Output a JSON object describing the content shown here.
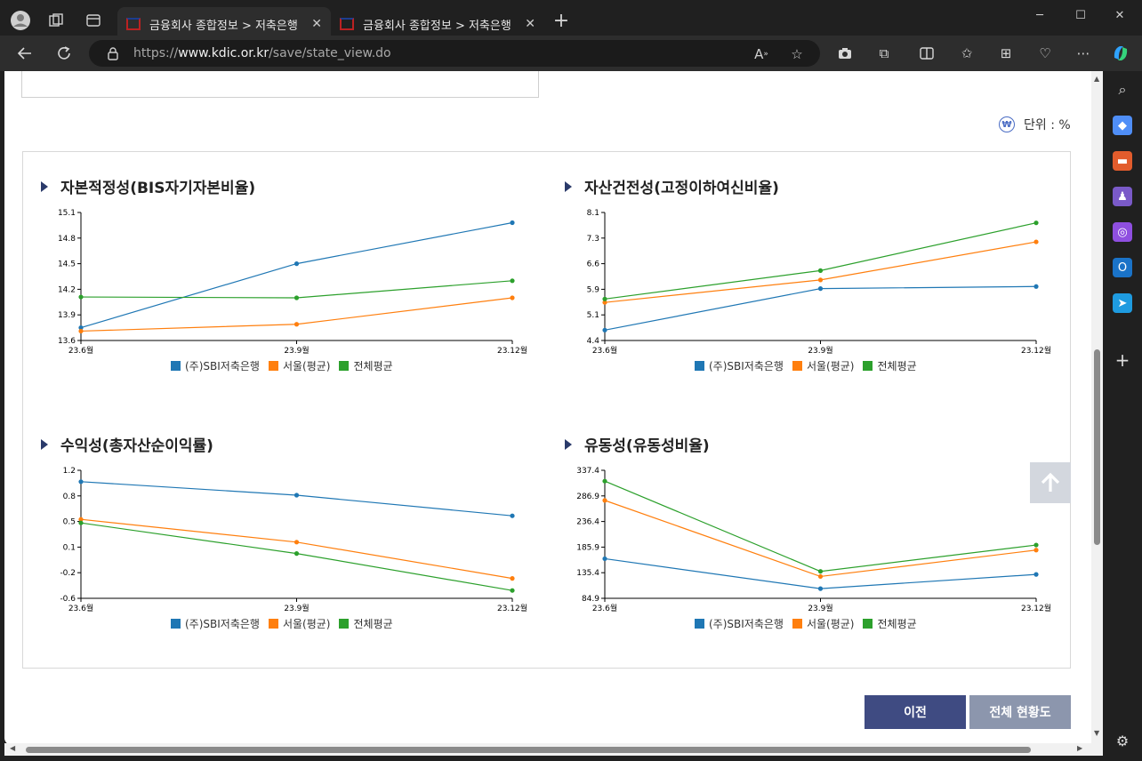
{
  "browser": {
    "tabs": [
      {
        "title": "금융회사 종합정보 > 저축은행 > ..."
      },
      {
        "title": "금융회사 종합정보 > 저축은행 > ..."
      }
    ],
    "url_prefix": "https://",
    "url_host": "www.kdic.or.kr",
    "url_path": "/save/state_view.do",
    "new_tab_label": "+"
  },
  "page": {
    "unit_icon": "₩",
    "unit_label": "단위 : %",
    "prev_button": "이전",
    "all_button": "전체 현황도"
  },
  "colors": {
    "sbi": "#1f77b4",
    "seoul": "#ff7f0e",
    "total": "#2ca02c",
    "accent": "#3f4b82"
  },
  "legend_labels": [
    "(주)SBI저축은행",
    "서울(평균)",
    "전체평균"
  ],
  "chart_data": [
    {
      "type": "line",
      "title": "자본적정성(BIS자기자본비율)",
      "categories": [
        "23.6월",
        "23.9월",
        "23.12월"
      ],
      "yticks": [
        "13.6",
        "13.9",
        "14.2",
        "14.5",
        "14.8",
        "15.1"
      ],
      "ylim": [
        13.6,
        15.1
      ],
      "series": [
        {
          "name": "(주)SBI저축은행",
          "values": [
            13.75,
            14.5,
            14.98
          ]
        },
        {
          "name": "서울(평균)",
          "values": [
            13.71,
            13.79,
            14.1
          ]
        },
        {
          "name": "전체평균",
          "values": [
            14.11,
            14.1,
            14.3
          ]
        }
      ]
    },
    {
      "type": "line",
      "title": "자산건전성(고정이하여신비율)",
      "categories": [
        "23.6월",
        "23.9월",
        "23.12월"
      ],
      "yticks": [
        "4.4",
        "5.1",
        "5.9",
        "6.6",
        "7.3",
        "8.1"
      ],
      "ylim": [
        4.4,
        8.1
      ],
      "series": [
        {
          "name": "(주)SBI저축은행",
          "values": [
            4.7,
            5.9,
            5.96
          ]
        },
        {
          "name": "서울(평균)",
          "values": [
            5.5,
            6.15,
            7.25
          ]
        },
        {
          "name": "전체평균",
          "values": [
            5.6,
            6.42,
            7.8
          ]
        }
      ]
    },
    {
      "type": "line",
      "title": "수익성(총자산순이익률)",
      "categories": [
        "23.6월",
        "23.9월",
        "23.12월"
      ],
      "yticks": [
        "-0.6",
        "-0.2",
        "0.1",
        "0.5",
        "0.8",
        "1.2"
      ],
      "ylim": [
        -0.6,
        1.2
      ],
      "series": [
        {
          "name": "(주)SBI저축은행",
          "values": [
            1.04,
            0.85,
            0.56
          ]
        },
        {
          "name": "서울(평균)",
          "values": [
            0.51,
            0.19,
            -0.32
          ]
        },
        {
          "name": "전체평균",
          "values": [
            0.46,
            0.03,
            -0.49
          ]
        }
      ]
    },
    {
      "type": "line",
      "title": "유동성(유동성비율)",
      "categories": [
        "23.6월",
        "23.9월",
        "23.12월"
      ],
      "yticks": [
        "84.9",
        "135.4",
        "185.9",
        "236.4",
        "286.9",
        "337.4"
      ],
      "ylim": [
        84.9,
        337.4
      ],
      "series": [
        {
          "name": "(주)SBI저축은행",
          "values": [
            163,
            104,
            132
          ]
        },
        {
          "name": "서울(평균)",
          "values": [
            278,
            128,
            180
          ]
        },
        {
          "name": "전체평균",
          "values": [
            316,
            138,
            190
          ]
        }
      ]
    }
  ]
}
